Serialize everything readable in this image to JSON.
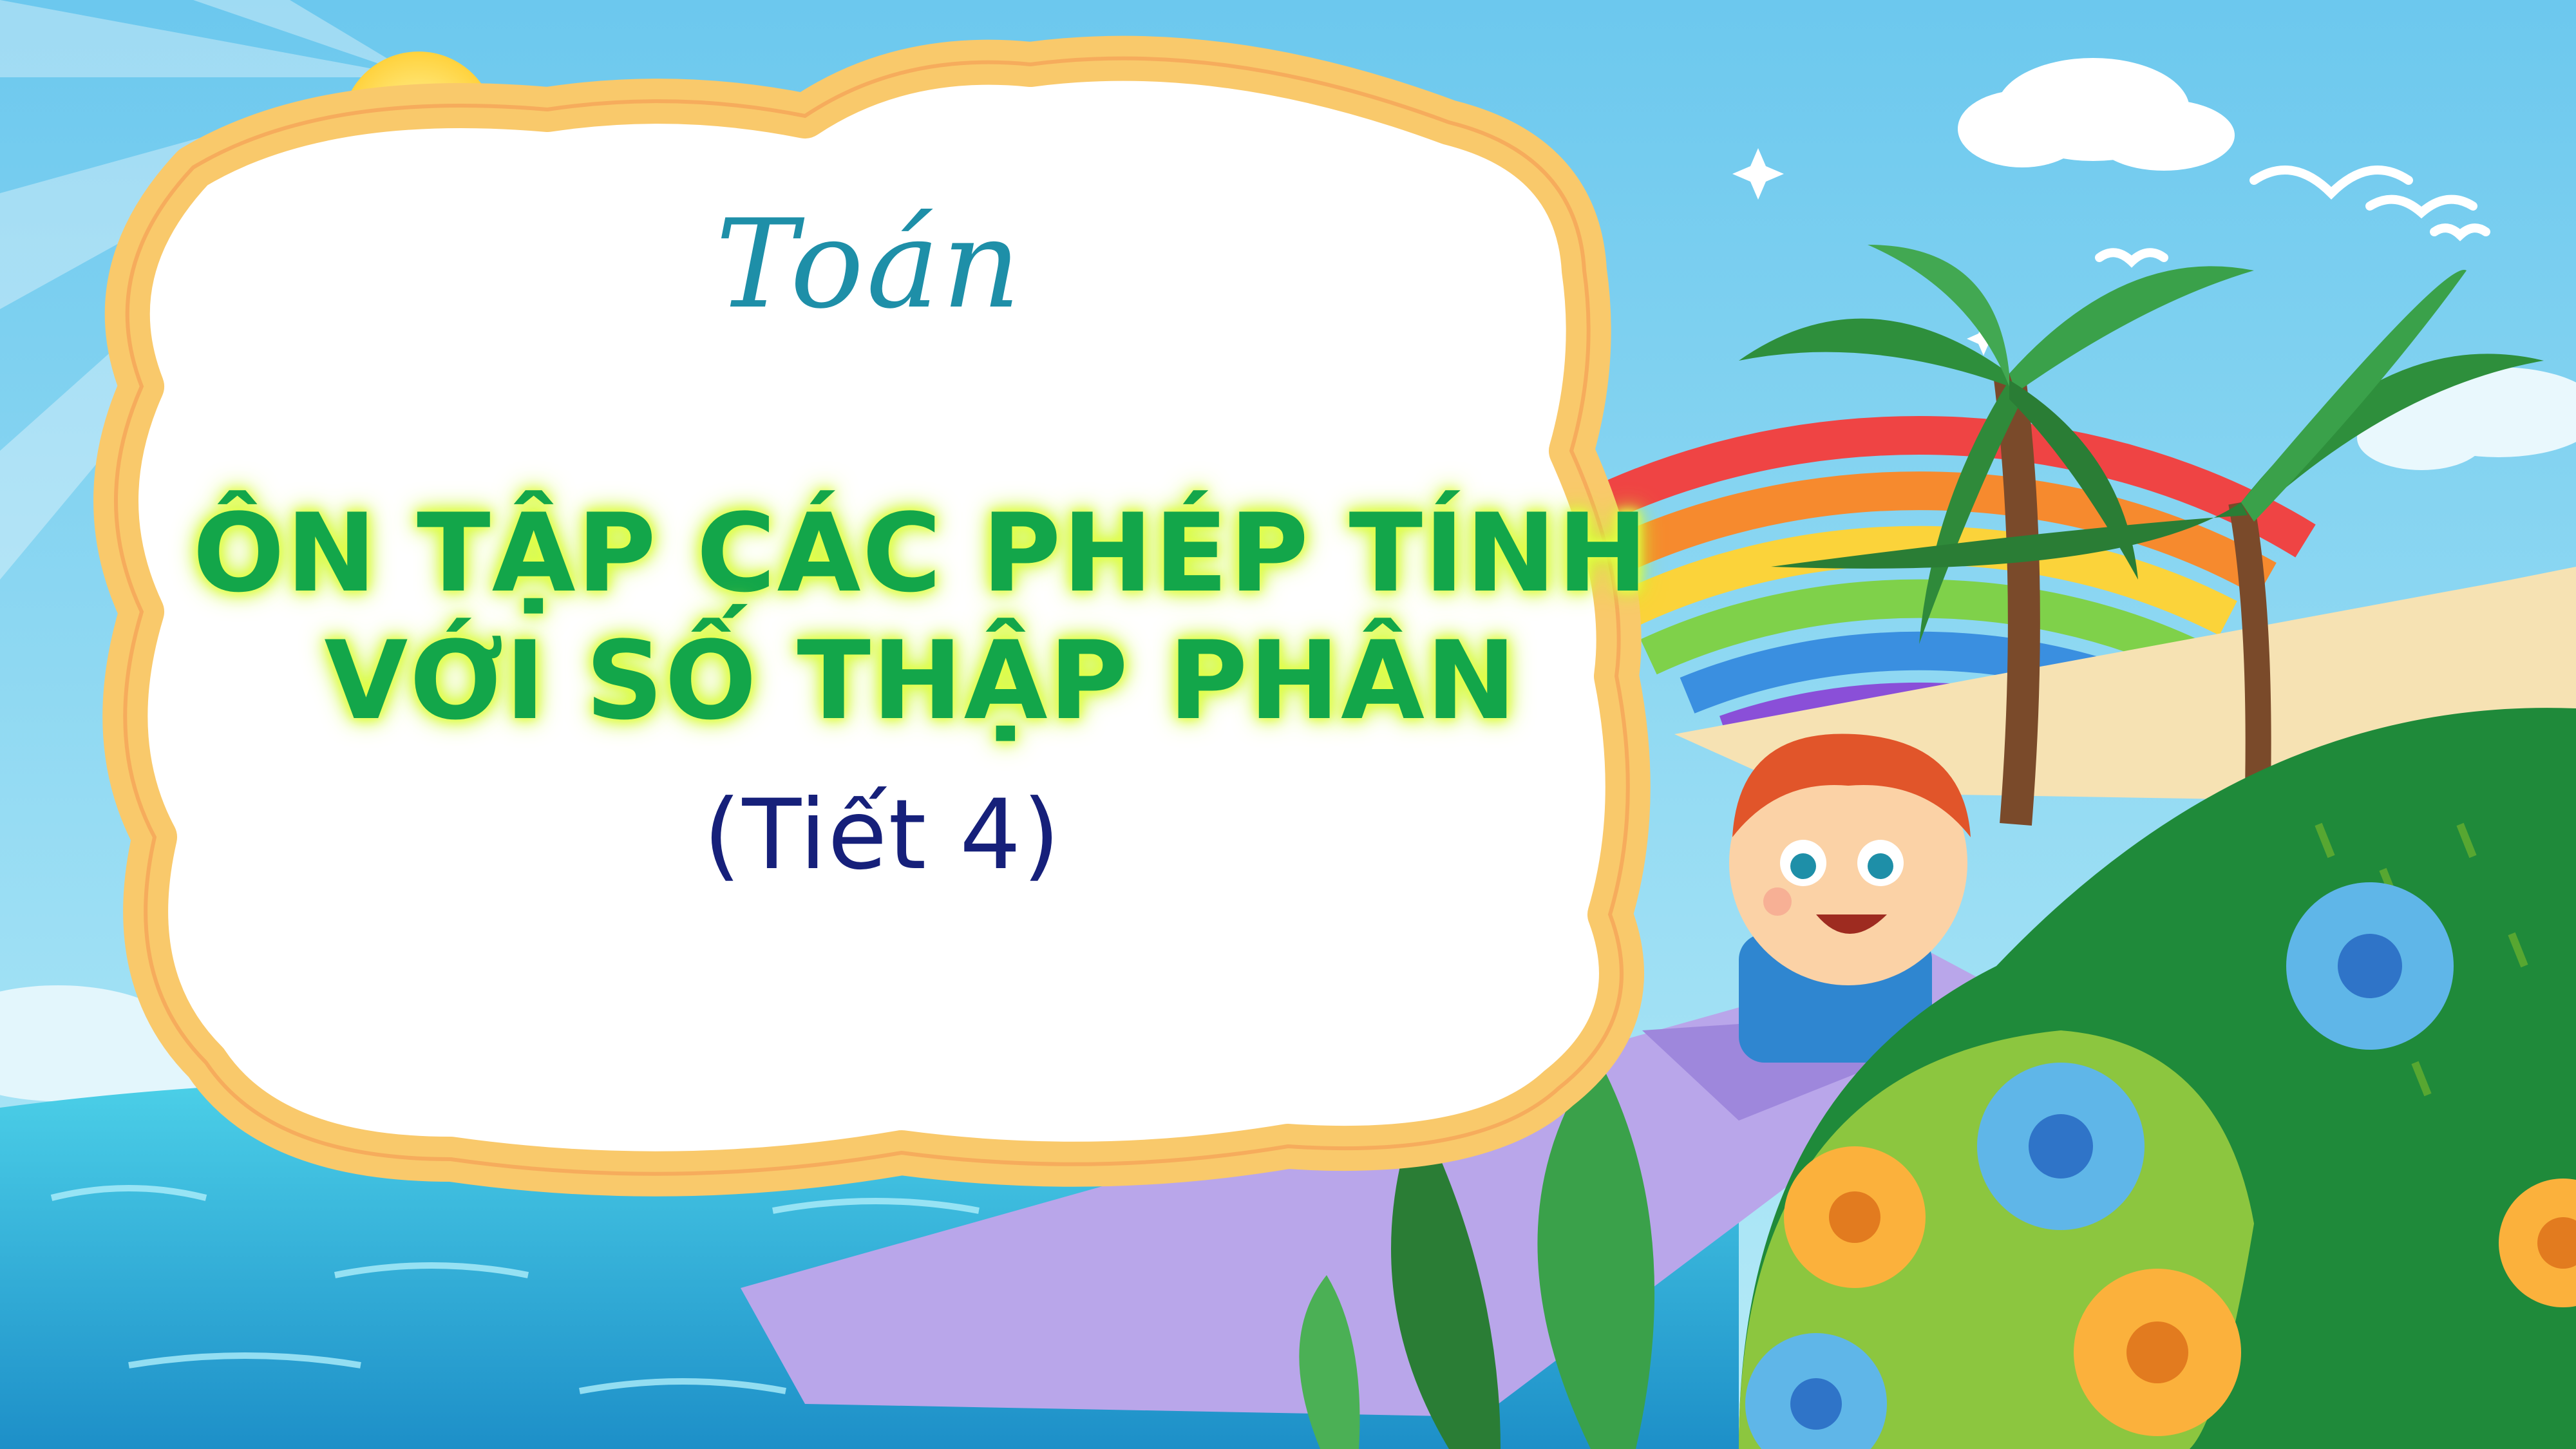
{
  "subject": "Toán",
  "title_lines": [
    "ÔN TẬP CÁC PHÉP TÍNH",
    "VỚI SỐ THẬP PHÂN"
  ],
  "period": "(Tiết 4)",
  "colors": {
    "subject": "#1e8fa8",
    "title": "#13a64a",
    "title_glow": "#e9ff4a",
    "period": "#16207a",
    "frame_border": "#f9c96b",
    "sky": "#7fd3f0",
    "sea": "#39bfe0"
  },
  "illustration": {
    "elements": [
      "sun",
      "clouds",
      "seagulls",
      "rainbow",
      "palm-trees",
      "boy",
      "paper-boat",
      "green-hill",
      "flowers",
      "sea",
      "cloud-frame"
    ]
  }
}
